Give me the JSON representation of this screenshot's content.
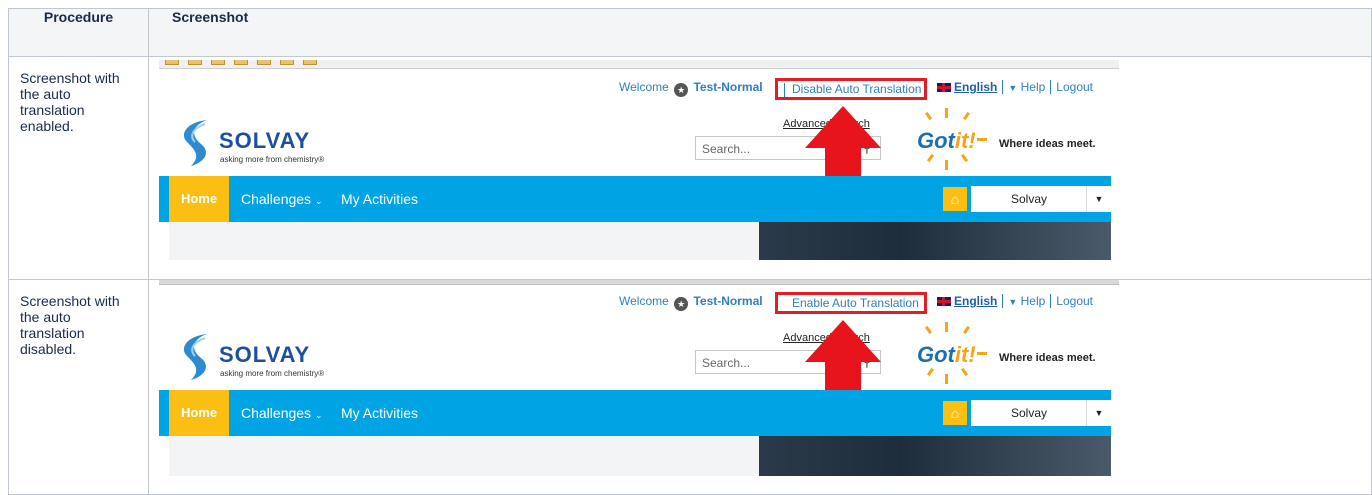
{
  "table": {
    "headers": {
      "procedure": "Procedure",
      "screenshot": "Screenshot"
    },
    "rows": [
      {
        "procedure": "Screenshot with the auto translation enabled."
      },
      {
        "procedure": "Screenshot with the auto translation disabled."
      }
    ]
  },
  "screens": [
    {
      "welcome": "Welcome",
      "username": "Test-Normal",
      "translation_link": "Disable Auto Translation",
      "language": "English",
      "help": "Help",
      "logout": "Logout",
      "brand": "SOLVAY",
      "brand_tagline": "asking more from chemistry®",
      "advanced_search": "Advanced Search",
      "search_placeholder": "Search...",
      "gotit_word_a": "Got",
      "gotit_word_b": "it!",
      "gotit_tagline": "Where ideas meet.",
      "nav_home": "Home",
      "nav_challenges": "Challenges",
      "nav_activities": "My Activities",
      "community_select": "Solvay"
    },
    {
      "welcome": "Welcome",
      "username": "Test-Normal",
      "translation_link": "Enable Auto Translation",
      "language": "English",
      "help": "Help",
      "logout": "Logout",
      "brand": "SOLVAY",
      "brand_tagline": "asking more from chemistry®",
      "advanced_search": "Advanced Search",
      "search_placeholder": "Search...",
      "gotit_word_a": "Got",
      "gotit_word_b": "it!",
      "gotit_tagline": "Where ideas meet.",
      "nav_home": "Home",
      "nav_challenges": "Challenges",
      "nav_activities": "My Activities",
      "community_select": "Solvay"
    }
  ],
  "colors": {
    "nav_blue": "#00a4e4",
    "home_yellow": "#fbbf14",
    "highlight_red": "#e01e24",
    "arrow_red": "#e8141b"
  },
  "icons": [
    "user-icon",
    "uk-flag-icon",
    "search-icon",
    "home-icon",
    "dropdown-arrow-icon",
    "red-up-arrow-icon",
    "solvay-logo-icon",
    "gotit-logo-icon"
  ]
}
